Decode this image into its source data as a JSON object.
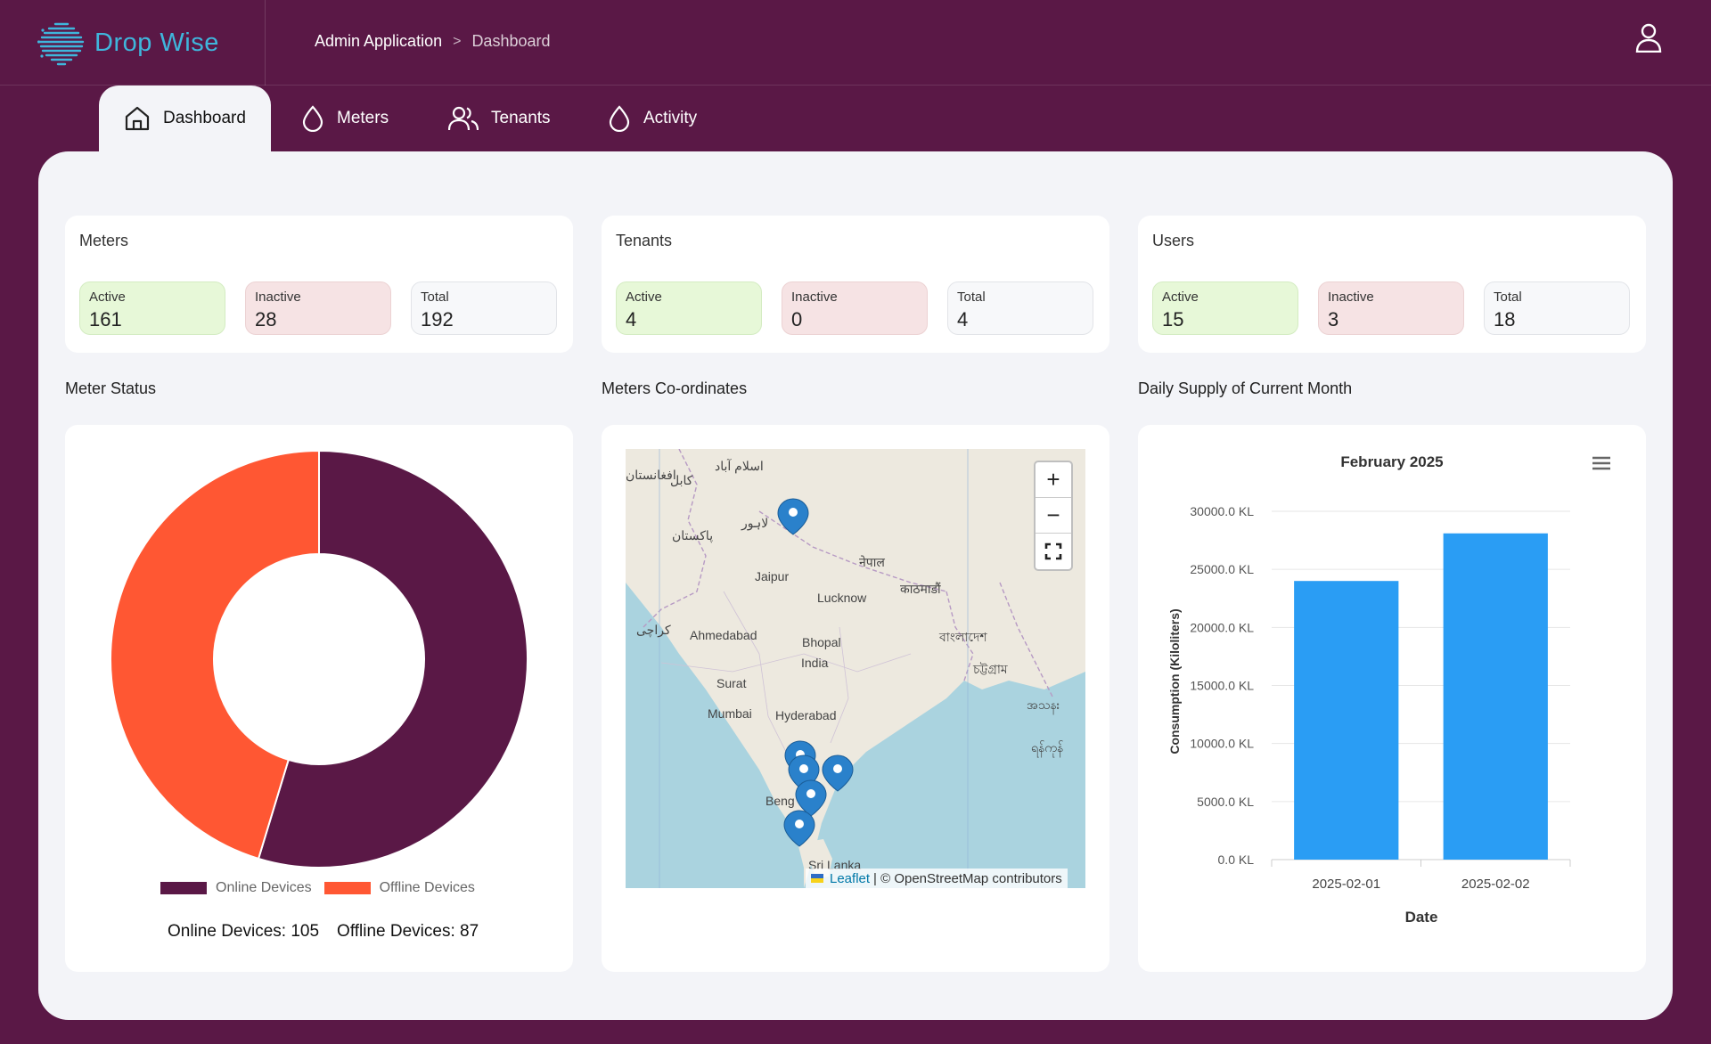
{
  "app": {
    "name": "Drop Wise"
  },
  "breadcrumb": {
    "root": "Admin Application",
    "separator": ">",
    "current": "Dashboard"
  },
  "tabs": [
    {
      "label": "Dashboard",
      "icon": "home-icon",
      "active": true
    },
    {
      "label": "Meters",
      "icon": "drop-icon"
    },
    {
      "label": "Tenants",
      "icon": "users-icon"
    },
    {
      "label": "Activity",
      "icon": "drop-icon"
    }
  ],
  "cards": {
    "meters": {
      "title": "Meters",
      "active_label": "Active",
      "active": "161",
      "inactive_label": "Inactive",
      "inactive": "28",
      "total_label": "Total",
      "total": "192"
    },
    "tenants": {
      "title": "Tenants",
      "active_label": "Active",
      "active": "4",
      "inactive_label": "Inactive",
      "inactive": "0",
      "total_label": "Total",
      "total": "4"
    },
    "users": {
      "title": "Users",
      "active_label": "Active",
      "active": "15",
      "inactive_label": "Inactive",
      "inactive": "3",
      "total_label": "Total",
      "total": "18"
    }
  },
  "sections": {
    "meter_status": "Meter Status",
    "coordinates": "Meters Co-ordinates",
    "daily_supply": "Daily Supply of Current Month"
  },
  "donut": {
    "online_label": "Online Devices",
    "offline_label": "Offline Devices",
    "online_count_text": "Online Devices: 105",
    "offline_count_text": "Offline Devices: 87",
    "colors": {
      "online": "#5a1846",
      "offline": "#ff5733"
    }
  },
  "map": {
    "zoom_in": "+",
    "zoom_out": "−",
    "attribution_link": "Leaflet",
    "attribution_text": "| © OpenStreetMap contributors",
    "labels": [
      "Jaipur",
      "Lucknow",
      "Ahmedabad",
      "Bhopal",
      "India",
      "Surat",
      "Mumbai",
      "Hyderabad",
      "Beng",
      "Sri Lanka",
      "नेपाल",
      "काठमाडौं",
      "বাংলাদেশ",
      "চট্টগ্রাম",
      "پاکستان",
      "لاہور",
      "کراچی",
      "کابل",
      "اسلام آباد",
      "အသနး",
      "ရန်ကုန်",
      "افغانستان"
    ]
  },
  "chart_data": {
    "type": "bar",
    "title": "February 2025",
    "categories": [
      "2025-02-01",
      "2025-02-02"
    ],
    "values": [
      24000,
      28100
    ],
    "xlabel": "Date",
    "ylabel": "Consumption (Kiloliters)",
    "ylim": [
      0,
      30000
    ],
    "yticks": [
      "0.0 KL",
      "5000.0 KL",
      "10000.0 KL",
      "15000.0 KL",
      "20000.0 KL",
      "25000.0 KL",
      "30000.0 KL"
    ],
    "color": "#2a9df4",
    "grid": true
  }
}
